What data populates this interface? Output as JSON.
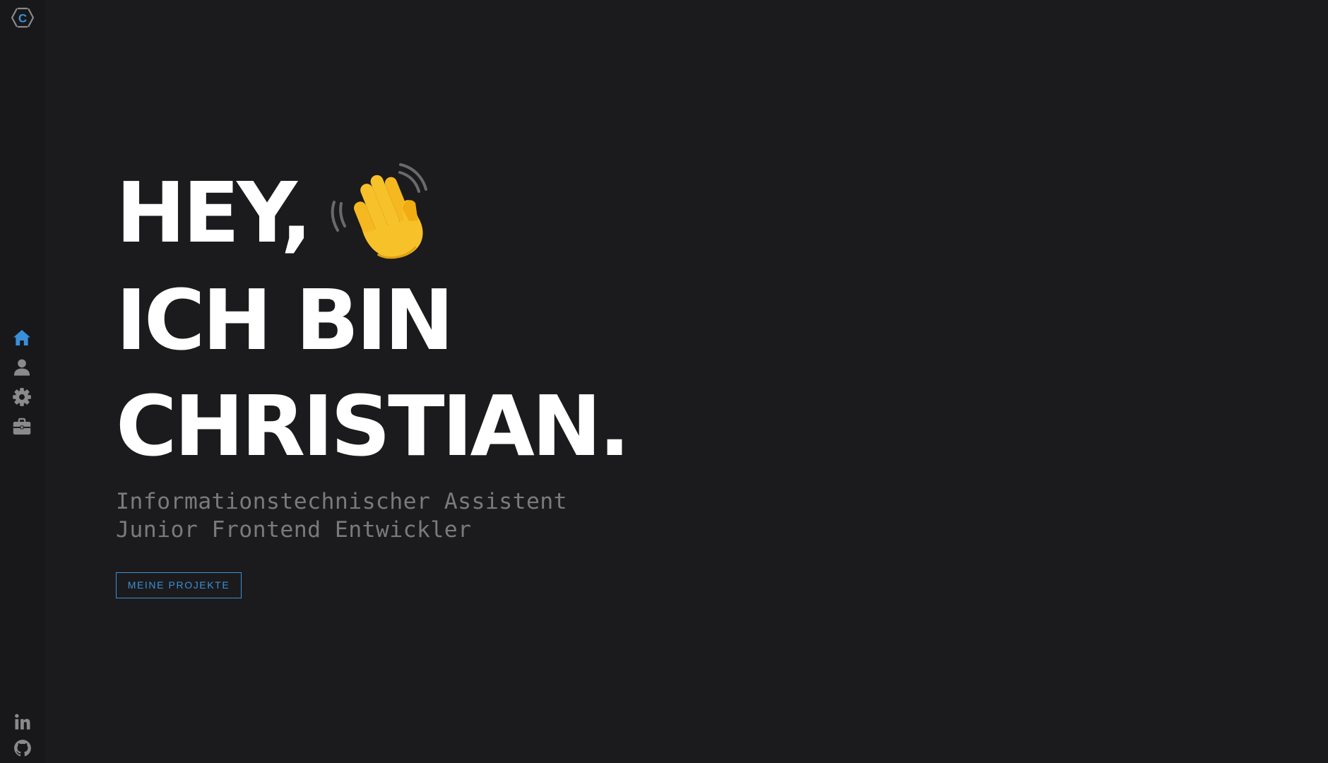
{
  "logo": {
    "letter": "C",
    "icon": "logo-hexagon-icon"
  },
  "sidebar": {
    "nav": [
      {
        "name": "home",
        "icon": "home-icon",
        "active": true
      },
      {
        "name": "about",
        "icon": "user-icon",
        "active": false
      },
      {
        "name": "skills",
        "icon": "gear-icon",
        "active": false
      },
      {
        "name": "projects",
        "icon": "briefcase-icon",
        "active": false
      }
    ],
    "social": [
      {
        "name": "linkedin",
        "icon": "linkedin-icon"
      },
      {
        "name": "github",
        "icon": "github-icon"
      }
    ]
  },
  "hero": {
    "line1": "HEY,",
    "wave_icon": "waving-hand-icon",
    "line2": "ICH BIN",
    "line3": "CHRISTIAN."
  },
  "subtitle": {
    "line1": "Informationstechnischer Assistent",
    "line2": "Junior Frontend Entwickler"
  },
  "cta": {
    "label": "MEINE PROJEKTE"
  },
  "colors": {
    "background": "#1b1b1d",
    "sidebar": "#18181a",
    "accent": "#3b8fd9",
    "icon_inactive": "#8a8a8c",
    "headline": "#ffffff",
    "subtitle": "#7a7a7c"
  }
}
